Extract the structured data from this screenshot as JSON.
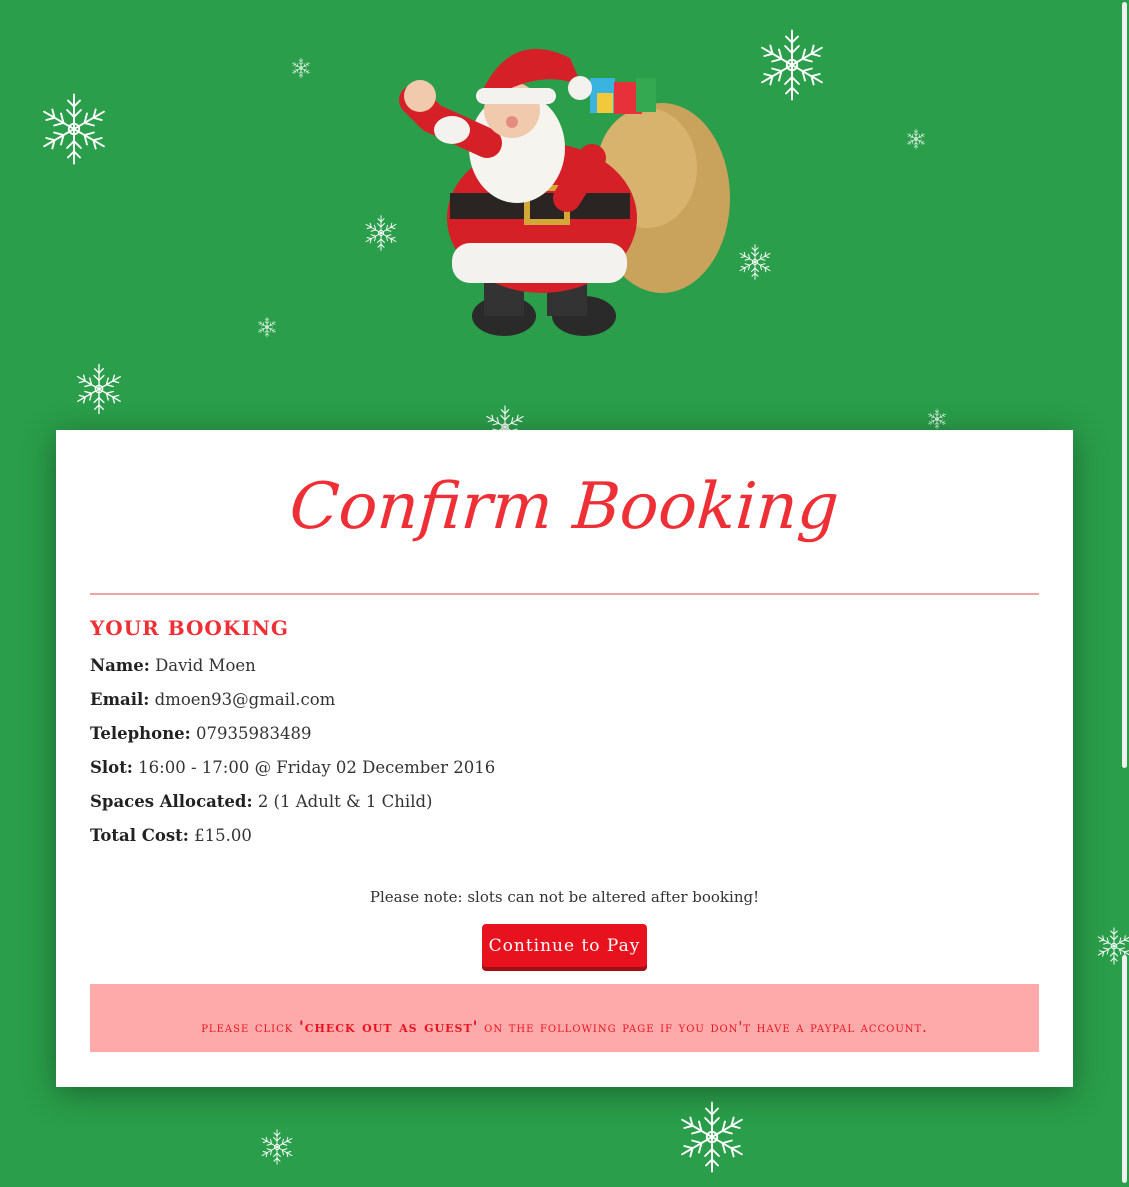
{
  "page": {
    "title": "Confirm Booking",
    "section_heading": "YOUR BOOKING"
  },
  "booking": {
    "name_label": "Name:",
    "name_value": "David Moen",
    "email_label": "Email:",
    "email_value": "dmoen93@gmail.com",
    "telephone_label": "Telephone:",
    "telephone_value": "07935983489",
    "slot_label": "Slot:",
    "slot_value": "16:00 - 17:00 @ Friday 02 December 2016",
    "spaces_label": "Spaces Allocated:",
    "spaces_value": "2 (1 Adult & 1 Child)",
    "cost_label": "Total Cost:",
    "cost_value": "£15.00"
  },
  "note": "Please note: slots can not be altered after booking!",
  "button": {
    "continue_label": "Continue to Pay"
  },
  "alert": {
    "prefix": "please click ",
    "emphasis": "'check out as guest'",
    "suffix": " on the following page if you don't have a paypal account."
  },
  "colors": {
    "background": "#2a9e4a",
    "accent_red": "#ee2f36",
    "button_red": "#e8121f",
    "alert_pink": "#ffaaaa"
  },
  "icons": [
    "snowflake-icon",
    "santa-illustration"
  ]
}
